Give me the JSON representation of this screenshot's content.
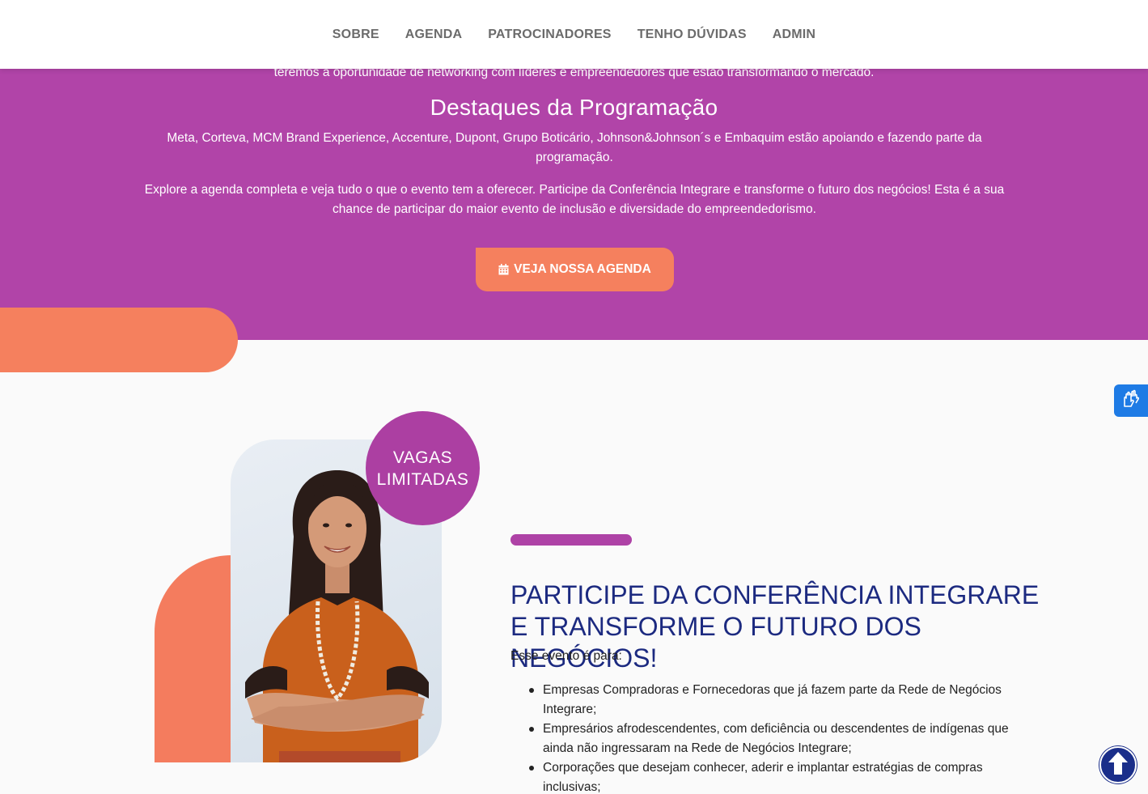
{
  "nav": {
    "items": [
      "SOBRE",
      "AGENDA",
      "PATROCINADORES",
      "TENHO DÚVIDAS",
      "ADMIN"
    ]
  },
  "hero": {
    "partial_line": "teremos a oportunidade de networking com líderes e empreendedores que estão transformando o mercado.",
    "heading": "Destaques da Programação",
    "paragraph1": "Meta, Corteva, MCM Brand Experience, Accenture, Dupont, Grupo Boticário, Johnson&Johnson´s e Embaquim estão apoiando e fazendo parte da programação.",
    "paragraph2": "Explore a agenda completa e veja tudo o que o evento tem a oferecer. Participe da Conferência Integrare e transforme o futuro dos negócios! Esta é a sua chance de participar do maior evento de inclusão e diversidade do empreendedorismo.",
    "cta_label": "VEJA NOSSA AGENDA",
    "cta_icon": "calendar-icon"
  },
  "badge": {
    "line1": "VAGAS",
    "line2": "LIMITADAS"
  },
  "section": {
    "heading": "PARTICIPE DA CONFERÊNCIA INTEGRARE E TRANSFORME O FUTURO DOS NEGÓCIOS!",
    "intro": "Esse evento é para:",
    "items": [
      "Empresas Compradoras e Fornecedoras que já fazem parte da Rede de Negócios Integrare;",
      "Empresários afrodescendentes, com deficiência ou descendentes de indígenas que ainda não ingressaram na Rede de Negócios Integrare;",
      "Corporações que desejam conhecer, aderir e implantar estratégias de compras inclusivas;"
    ]
  },
  "widgets": {
    "accessibility_icon": "sign-language-hands-icon",
    "scroll_top_icon": "arrow-up-icon"
  },
  "colors": {
    "purple": "#b144a8",
    "orange": "#f5805e",
    "navy": "#1c2a80",
    "accessibility_blue": "#1e7be5"
  }
}
